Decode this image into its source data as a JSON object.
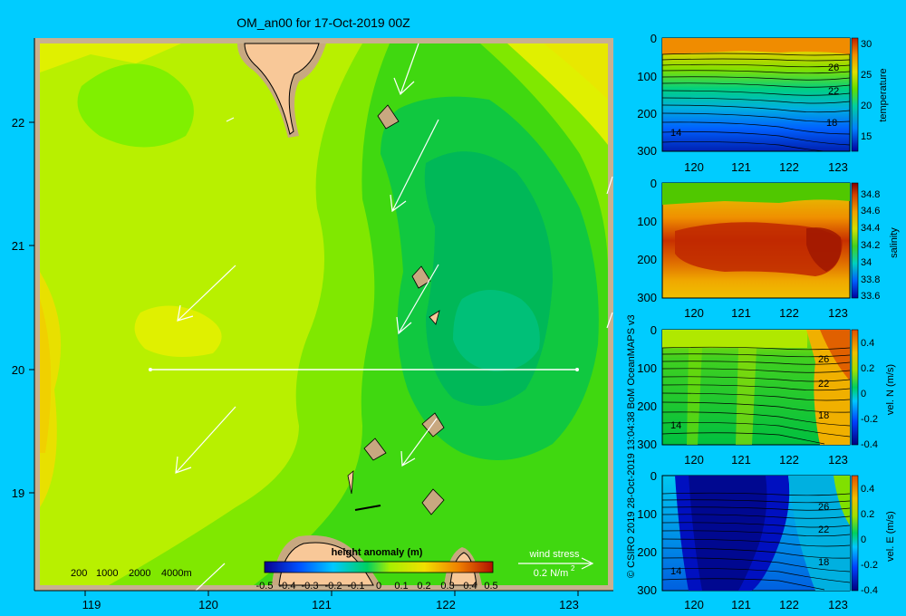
{
  "main_title": "OM_an00 for 17-Oct-2019 00Z",
  "credit": "© CSIRO 2019   28-Oct-2019 13:04:38 BoM OceanMAPS v3",
  "map": {
    "x_ticks": [
      "119",
      "120",
      "121",
      "122",
      "123"
    ],
    "y_ticks": [
      "22",
      "21",
      "20",
      "19"
    ],
    "bathymetry_legend": [
      "200",
      "1000",
      "2000",
      "4000m"
    ],
    "colorbar_title": "height anomaly (m)",
    "colorbar_ticks": [
      "-0.5",
      "-0.4",
      "-0.3",
      "-0.2",
      "-0.1",
      "0",
      "0.1",
      "0.2",
      "0.3",
      "0.4",
      "0.5"
    ],
    "wind_title": "wind stress",
    "wind_scale": "0.2 N/m",
    "wind_scale_sup": "2"
  },
  "panels": [
    {
      "variable": "temperature",
      "y_ticks": [
        "0",
        "100",
        "200",
        "300"
      ],
      "x_ticks": [
        "120",
        "121",
        "122",
        "123"
      ],
      "colorbar_ticks": [
        "30",
        "25",
        "20",
        "15"
      ],
      "contour_labels": [
        "26",
        "22",
        "18",
        "14"
      ]
    },
    {
      "variable": "salinity",
      "y_ticks": [
        "0",
        "100",
        "200",
        "300"
      ],
      "x_ticks": [
        "120",
        "121",
        "122",
        "123"
      ],
      "colorbar_ticks": [
        "34.8",
        "34.6",
        "34.4",
        "34.2",
        "34",
        "33.8",
        "33.6"
      ],
      "contour_labels": []
    },
    {
      "variable": "vel. N  (m/s)",
      "y_ticks": [
        "0",
        "100",
        "200",
        "300"
      ],
      "x_ticks": [
        "120",
        "121",
        "122",
        "123"
      ],
      "colorbar_ticks": [
        "0.4",
        "0.2",
        "0",
        "-0.2",
        "-0.4"
      ],
      "contour_labels": [
        "26",
        "22",
        "18",
        "14"
      ]
    },
    {
      "variable": "vel. E  (m/s)",
      "y_ticks": [
        "0",
        "100",
        "200",
        "300"
      ],
      "x_ticks": [
        "120",
        "121",
        "122",
        "123"
      ],
      "colorbar_ticks": [
        "0.4",
        "0.2",
        "0",
        "-0.2",
        "-0.4"
      ],
      "contour_labels": [
        "26",
        "22",
        "18",
        "14"
      ]
    }
  ],
  "chart_data": [
    {
      "type": "heatmap",
      "title": "OM_an00 for 17-Oct-2019 00Z",
      "variable": "height anomaly (m)",
      "xlim": [
        118.5,
        123.5
      ],
      "ylim": [
        18.25,
        22.7
      ],
      "x_ticks": [
        119,
        120,
        121,
        122,
        123
      ],
      "y_ticks": [
        19,
        20,
        21,
        22
      ],
      "colorbar_range": [
        -0.5,
        0.5
      ],
      "section_line": {
        "lon": [
          119.5,
          123.0
        ],
        "lat": [
          20.0,
          20.0
        ]
      },
      "wind_stress_scale_Nm2": 0.2
    },
    {
      "type": "heatmap",
      "variable": "temperature",
      "x_range": [
        119.5,
        123.1
      ],
      "depth_range": [
        0,
        300
      ],
      "colorbar_range": [
        13,
        31
      ],
      "contour_levels": [
        14,
        18,
        22,
        26
      ]
    },
    {
      "type": "heatmap",
      "variable": "salinity",
      "x_range": [
        119.5,
        123.1
      ],
      "depth_range": [
        0,
        300
      ],
      "colorbar_range": [
        33.55,
        34.9
      ]
    },
    {
      "type": "heatmap",
      "variable": "vel. N (m/s)",
      "x_range": [
        119.5,
        123.1
      ],
      "depth_range": [
        0,
        300
      ],
      "colorbar_range": [
        -0.45,
        0.45
      ]
    },
    {
      "type": "heatmap",
      "variable": "vel. E (m/s)",
      "x_range": [
        119.5,
        123.1
      ],
      "depth_range": [
        0,
        300
      ],
      "colorbar_range": [
        -0.45,
        0.45
      ]
    }
  ]
}
